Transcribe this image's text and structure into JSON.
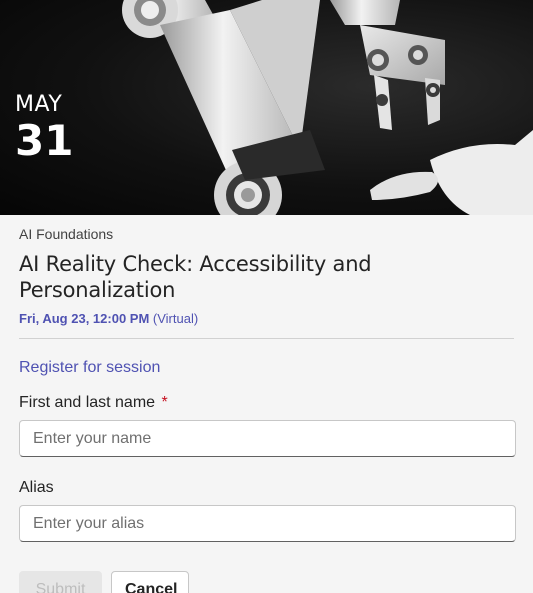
{
  "event": {
    "date_month": "MAY",
    "date_day": "31",
    "series": "AI Foundations",
    "title": "AI Reality Check: Accessibility and Personalization",
    "time": "Fri, Aug 23, 12:00 PM",
    "location": "(Virtual)"
  },
  "registration": {
    "heading": "Register for session",
    "name_label": "First and last name",
    "required_mark": "*",
    "name_placeholder": "Enter your name",
    "name_value": "",
    "alias_label": "Alias",
    "alias_placeholder": "Enter your alias",
    "alias_value": ""
  },
  "actions": {
    "submit_label": "Submit",
    "submit_disabled": true,
    "cancel_label": "Cancel"
  },
  "colors": {
    "accent": "#4f52b2",
    "required": "#c50f1f",
    "hero_background": "#111111"
  },
  "hero_image": {
    "icon": "robot-arm-and-hand-illustration"
  }
}
